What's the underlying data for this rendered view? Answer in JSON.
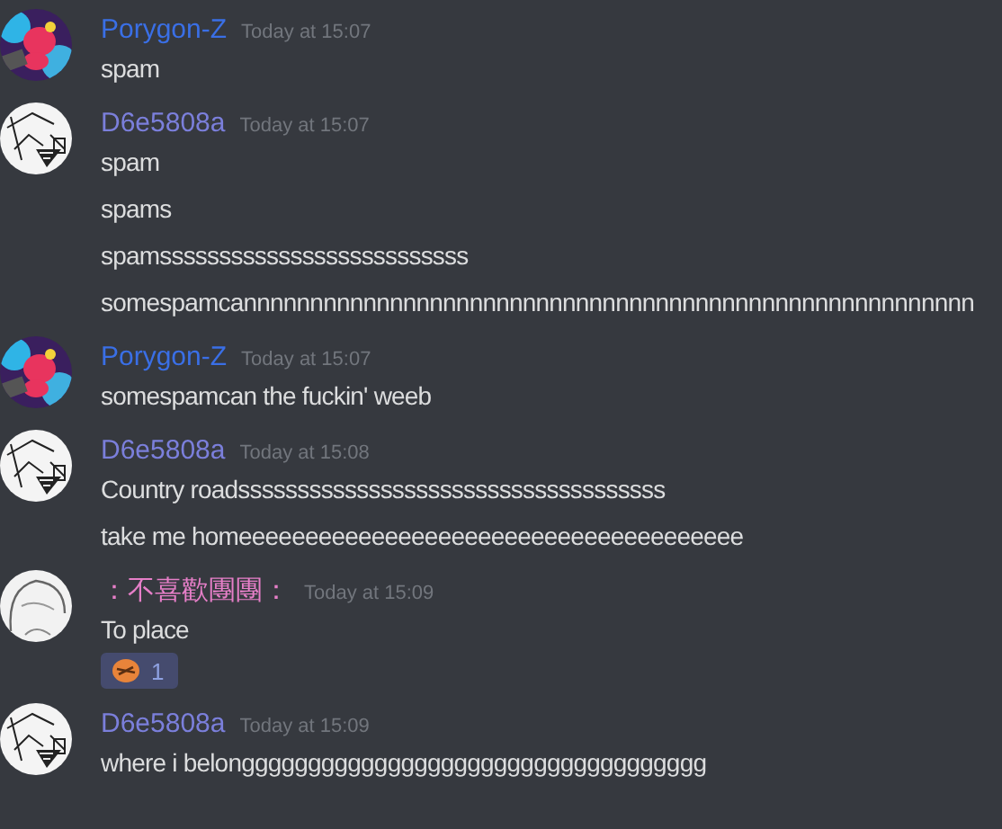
{
  "messages": [
    {
      "author": "Porygon-Z",
      "color": "#3a6fe6",
      "avatar": {
        "kind": "colorful"
      },
      "time": "Today at 15:07",
      "lines": [
        "spam"
      ]
    },
    {
      "author": "D6e5808a",
      "color": "#7b7fdb",
      "avatar": {
        "kind": "sketch"
      },
      "time": "Today at 15:07",
      "lines": [
        "spam",
        "spams",
        "spamssssssssssssssssssssssssss",
        "somespamcannnnnnnnnnnnnnnnnnnnnnnnnnnnnnnnnnnnnnnnnnnnnnnnnnnnnnn"
      ]
    },
    {
      "author": "Porygon-Z",
      "color": "#3a6fe6",
      "avatar": {
        "kind": "colorful"
      },
      "time": "Today at 15:07",
      "lines": [
        "somespamcan the fuckin' weeb"
      ]
    },
    {
      "author": "D6e5808a",
      "color": "#7b7fdb",
      "avatar": {
        "kind": "sketch"
      },
      "time": "Today at 15:08",
      "lines": [
        "Country roadssssssssssssssssssssssssssssssssssss",
        "take me homeeeeeeeeeeeeeeeeeeeeeeeeeeeeeeeeeeeeee"
      ]
    },
    {
      "author": "：不喜歡團團：",
      "color": "#e67fc8",
      "avatar": {
        "kind": "outline"
      },
      "time": "Today at 15:09",
      "lines": [
        "To place"
      ],
      "reactions": [
        {
          "count": "1",
          "reacted": true
        }
      ]
    },
    {
      "author": "D6e5808a",
      "color": "#7b7fdb",
      "avatar": {
        "kind": "sketch"
      },
      "time": "Today at 15:09",
      "lines": [
        "where i belonggggggggggggggggggggggggggggggggggg"
      ]
    }
  ]
}
